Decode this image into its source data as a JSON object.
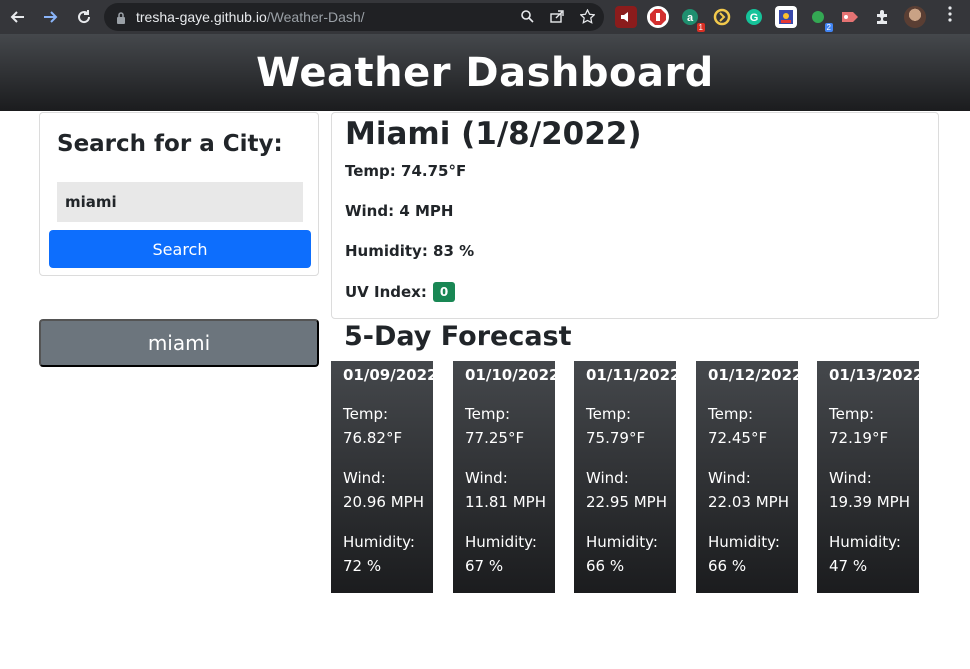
{
  "browser": {
    "url_host": "tresha-gaye.github.io",
    "url_path": "/Weather-Dash/",
    "extension_badges": [
      "1",
      "2"
    ]
  },
  "header": {
    "title": "Weather Dashboard"
  },
  "search": {
    "heading": "Search for a City:",
    "input_value": "miami",
    "button_label": "Search"
  },
  "history": {
    "items": [
      "miami"
    ]
  },
  "current": {
    "city_date": "Miami (1/8/2022)",
    "temp": "Temp: 74.75°F",
    "wind": "Wind: 4 MPH",
    "humidity": "Humidity: 83 %",
    "uv_label": "UV Index:",
    "uv_value": "0",
    "uv_color": "#198754"
  },
  "forecast": {
    "heading": "5-Day Forecast",
    "days": [
      {
        "date": "01/09/2022",
        "temp_label": "Temp:",
        "temp": "76.82°F",
        "wind_label": "Wind:",
        "wind": "20.96 MPH",
        "humidity_label": "Humidity:",
        "humidity": "72 %"
      },
      {
        "date": "01/10/2022",
        "temp_label": "Temp:",
        "temp": "77.25°F",
        "wind_label": "Wind:",
        "wind": "11.81 MPH",
        "humidity_label": "Humidity:",
        "humidity": "67 %"
      },
      {
        "date": "01/11/2022",
        "temp_label": "Temp:",
        "temp": "75.79°F",
        "wind_label": "Wind:",
        "wind": "22.95 MPH",
        "humidity_label": "Humidity:",
        "humidity": "66 %"
      },
      {
        "date": "01/12/2022",
        "temp_label": "Temp:",
        "temp": "72.45°F",
        "wind_label": "Wind:",
        "wind": "22.03 MPH",
        "humidity_label": "Humidity:",
        "humidity": "66 %"
      },
      {
        "date": "01/13/2022",
        "temp_label": "Temp:",
        "temp": "72.19°F",
        "wind_label": "Wind:",
        "wind": "19.39 MPH",
        "humidity_label": "Humidity:",
        "humidity": "47 %"
      }
    ]
  },
  "colors": {
    "search_button": "#0d6efd",
    "history_button": "#6c757d",
    "header_gradient_top": "#45484c",
    "header_gradient_bottom": "#1b1c1e"
  }
}
